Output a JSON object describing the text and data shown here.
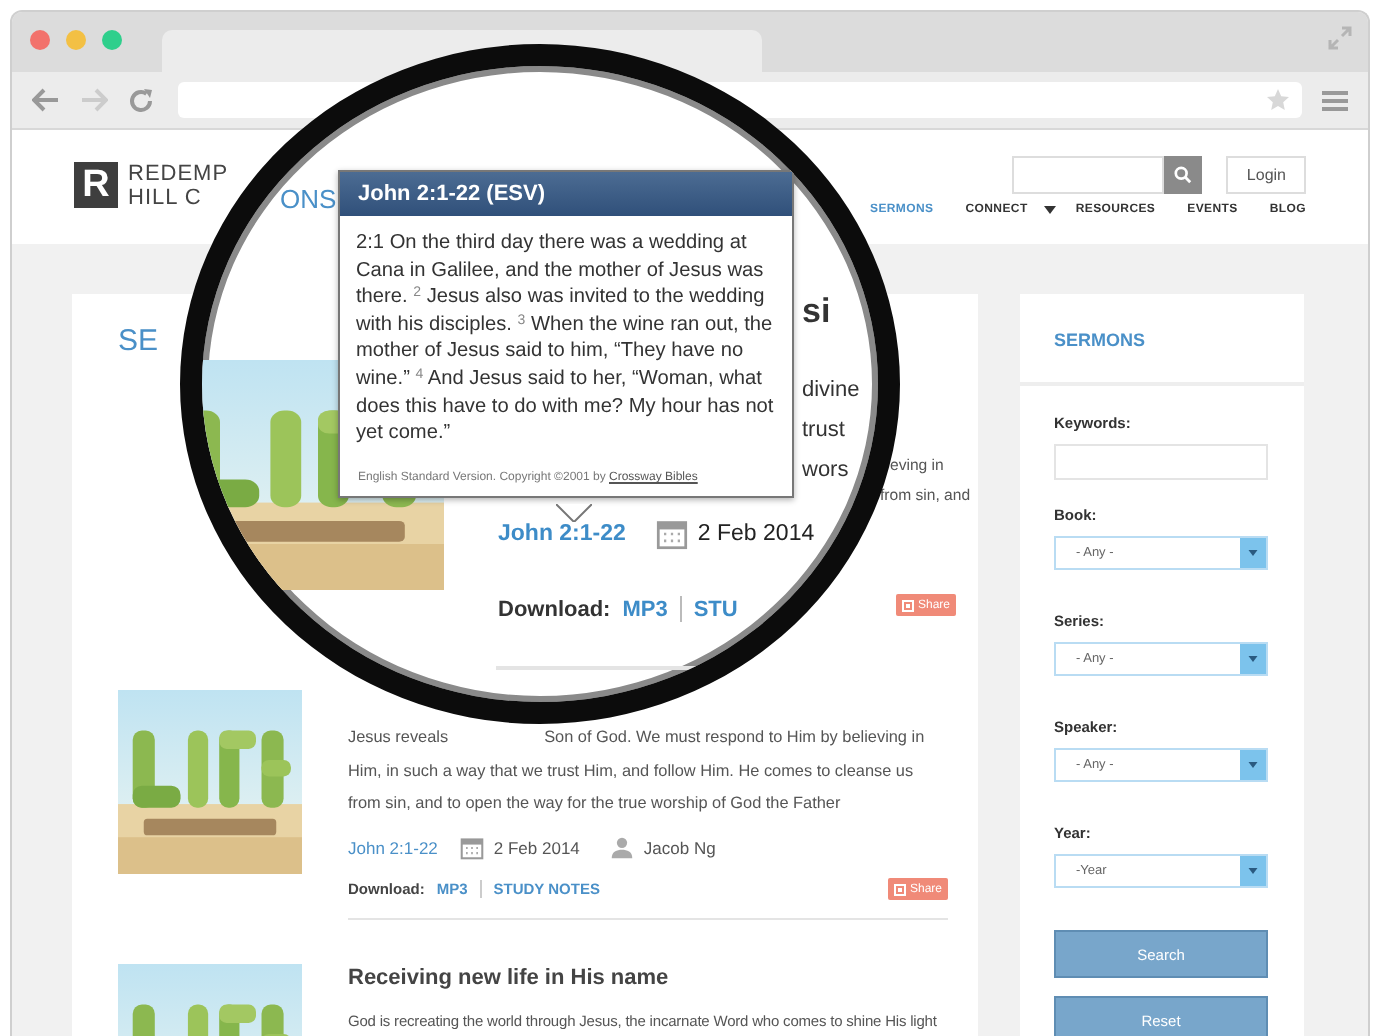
{
  "header": {
    "logo": {
      "mark": "R",
      "lines": [
        "REDEMP",
        "HILL C"
      ]
    },
    "login": "Login",
    "nav": [
      {
        "label": "SERMONS",
        "selected": true,
        "has_menu": false
      },
      {
        "label": "CONNECT",
        "selected": false,
        "has_menu": true
      },
      {
        "label": "RESOURCES",
        "selected": false,
        "has_menu": false
      },
      {
        "label": "EVENTS",
        "selected": false,
        "has_menu": false
      },
      {
        "label": "BLOG",
        "selected": false,
        "has_menu": false
      }
    ]
  },
  "main": {
    "title": "SE",
    "first_sermon": {
      "text_fragments": [
        "eving in",
        "from sin, and"
      ],
      "share": "Share"
    },
    "sermons": [
      {
        "kind": "full",
        "description_start": "Jesus reveals",
        "description_line_rest": "Son of God. We must respond to Him by believing in",
        "description": "Him, in such a way that we trust Him, and follow Him. He comes to cleanse us from sin, and to open the way for the true worship of God the Father",
        "passage": "John 2:1-22",
        "date": "2 Feb 2014",
        "speaker": "Jacob Ng",
        "download_label": "Download:",
        "downloads": [
          "MP3",
          "STUDY NOTES"
        ],
        "share": "Share"
      },
      {
        "kind": "teaser",
        "title": "Receiving new life in His name",
        "description": "God is recreating the world through Jesus, the incarnate Word who comes to shine His light"
      }
    ]
  },
  "sidebar": {
    "title": "SERMONS",
    "fields": [
      {
        "kind": "text",
        "label": "Keywords:"
      },
      {
        "kind": "select",
        "label": "Book:",
        "value": "- Any -"
      },
      {
        "kind": "select",
        "label": "Series:",
        "value": "- Any -"
      },
      {
        "kind": "select",
        "label": "Speaker:",
        "value": "- Any -"
      },
      {
        "kind": "select",
        "label": "Year:",
        "value": "-Year"
      }
    ],
    "buttons": [
      "Search",
      "Reset"
    ]
  },
  "magnifier": {
    "heading_fragment": "ONS",
    "popover": {
      "title": "John 2:1-22 (ESV)",
      "text": "2:1 On the third day there was a wedding at Cana in Galilee, and the mother of Jesus was there. $^{2}$ Jesus also was invited to the wedding with his disciples. $^{3}$ When the wine ran out, the mother of Jesus said to him, “They have no wine.” $^{4}$ And Jesus said to her, “Woman, what does this have to do with me? My hour has not yet come.”",
      "footer": "English Standard Version. Copyright ©2001 by",
      "link": "Crossway Bibles"
    },
    "title_fragment": "si",
    "text_fragments": [
      "divine",
      "trust",
      "wors"
    ],
    "passage": "John 2:1-22",
    "date": "2 Feb 2014",
    "download_label": "Download:",
    "downloads": [
      "MP3",
      "STU"
    ]
  }
}
